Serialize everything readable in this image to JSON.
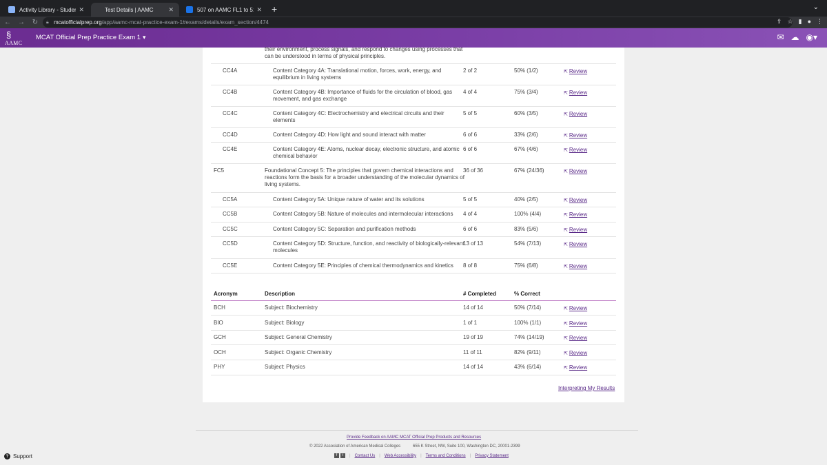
{
  "browser": {
    "tabs": [
      {
        "title": "Activity Library - Student Cour",
        "active": false,
        "favicon_color": "#8ab4f8"
      },
      {
        "title": "Test Details | AAMC",
        "active": true,
        "favicon_color": "#35363a"
      },
      {
        "title": "507 on AAMC FL1 to 518 on ac",
        "active": false,
        "favicon_color": "#1a73e8"
      }
    ],
    "url_domain": "mcatofficialprep.org",
    "url_path": "/app/aamc-mcat-practice-exam-1#exams/details/exam_section/4474"
  },
  "header": {
    "logo_text": "AAMC",
    "exam_title": "MCAT Official Prep Practice Exam 1"
  },
  "review_label": "Review",
  "fc4_desc_tail": "their environment, process signals, and respond to changes using processes that can be understood in terms of physical principles.",
  "concept_rows": [
    {
      "acronym": "CC4A",
      "sub": true,
      "description": "Content Category 4A: Translational motion, forces, work, energy, and equilibrium in living systems",
      "completed": "2 of 2",
      "correct": "50% (1/2)"
    },
    {
      "acronym": "CC4B",
      "sub": true,
      "description": "Content Category 4B: Importance of fluids for the circulation of blood, gas movement, and gas exchange",
      "completed": "4 of 4",
      "correct": "75% (3/4)"
    },
    {
      "acronym": "CC4C",
      "sub": true,
      "description": "Content Category 4C: Electrochemistry and electrical circuits and their elements",
      "completed": "5 of 5",
      "correct": "60% (3/5)"
    },
    {
      "acronym": "CC4D",
      "sub": true,
      "description": "Content Category 4D: How light and sound interact with matter",
      "completed": "6 of 6",
      "correct": "33% (2/6)"
    },
    {
      "acronym": "CC4E",
      "sub": true,
      "description": "Content Category 4E: Atoms, nuclear decay, electronic structure, and atomic chemical behavior",
      "completed": "6 of 6",
      "correct": "67% (4/6)"
    },
    {
      "acronym": "FC5",
      "sub": false,
      "description": "Foundational Concept 5: The principles that govern chemical interactions and reactions form the basis for a broader understanding of the molecular dynamics of living systems.",
      "completed": "36 of 36",
      "correct": "67% (24/36)"
    },
    {
      "acronym": "CC5A",
      "sub": true,
      "description": "Content Category 5A: Unique nature of water and its solutions",
      "completed": "5 of 5",
      "correct": "40% (2/5)"
    },
    {
      "acronym": "CC5B",
      "sub": true,
      "description": "Content Category 5B: Nature of molecules and intermolecular interactions",
      "completed": "4 of 4",
      "correct": "100% (4/4)"
    },
    {
      "acronym": "CC5C",
      "sub": true,
      "description": "Content Category 5C: Separation and purification methods",
      "completed": "6 of 6",
      "correct": "83% (5/6)"
    },
    {
      "acronym": "CC5D",
      "sub": true,
      "description": "Content Category 5D: Structure, function, and reactivity of biologically-relevant molecules",
      "completed": "13 of 13",
      "correct": "54% (7/13)"
    },
    {
      "acronym": "CC5E",
      "sub": true,
      "description": "Content Category 5E: Principles of chemical thermodynamics and kinetics",
      "completed": "8 of 8",
      "correct": "75% (6/8)"
    }
  ],
  "subject_table": {
    "headers": {
      "acronym": "Acronym",
      "description": "Description",
      "completed": "# Completed",
      "correct": "% Correct"
    },
    "rows": [
      {
        "acronym": "BCH",
        "description": "Subject: Biochemistry",
        "completed": "14 of 14",
        "correct": "50% (7/14)"
      },
      {
        "acronym": "BIO",
        "description": "Subject: Biology",
        "completed": "1 of 1",
        "correct": "100% (1/1)"
      },
      {
        "acronym": "GCH",
        "description": "Subject: General Chemistry",
        "completed": "19 of 19",
        "correct": "74% (14/19)"
      },
      {
        "acronym": "OCH",
        "description": "Subject: Organic Chemistry",
        "completed": "11 of 11",
        "correct": "82% (9/11)"
      },
      {
        "acronym": "PHY",
        "description": "Subject: Physics",
        "completed": "14 of 14",
        "correct": "43% (6/14)"
      }
    ]
  },
  "interpreting_link": "Interpreting My Results",
  "footer": {
    "feedback_link": "Provide Feedback on AAMC MCAT Official Prep Products and Resources",
    "copyright": "© 2022 Association of American Medical Colleges",
    "address": "655 K Street, NW, Suite 100, Washington DC, 20001-2399",
    "links": [
      "Contact Us",
      "Web Accessibility",
      "Terms and Conditions",
      "Privacy Statement"
    ]
  },
  "support_label": "Support"
}
